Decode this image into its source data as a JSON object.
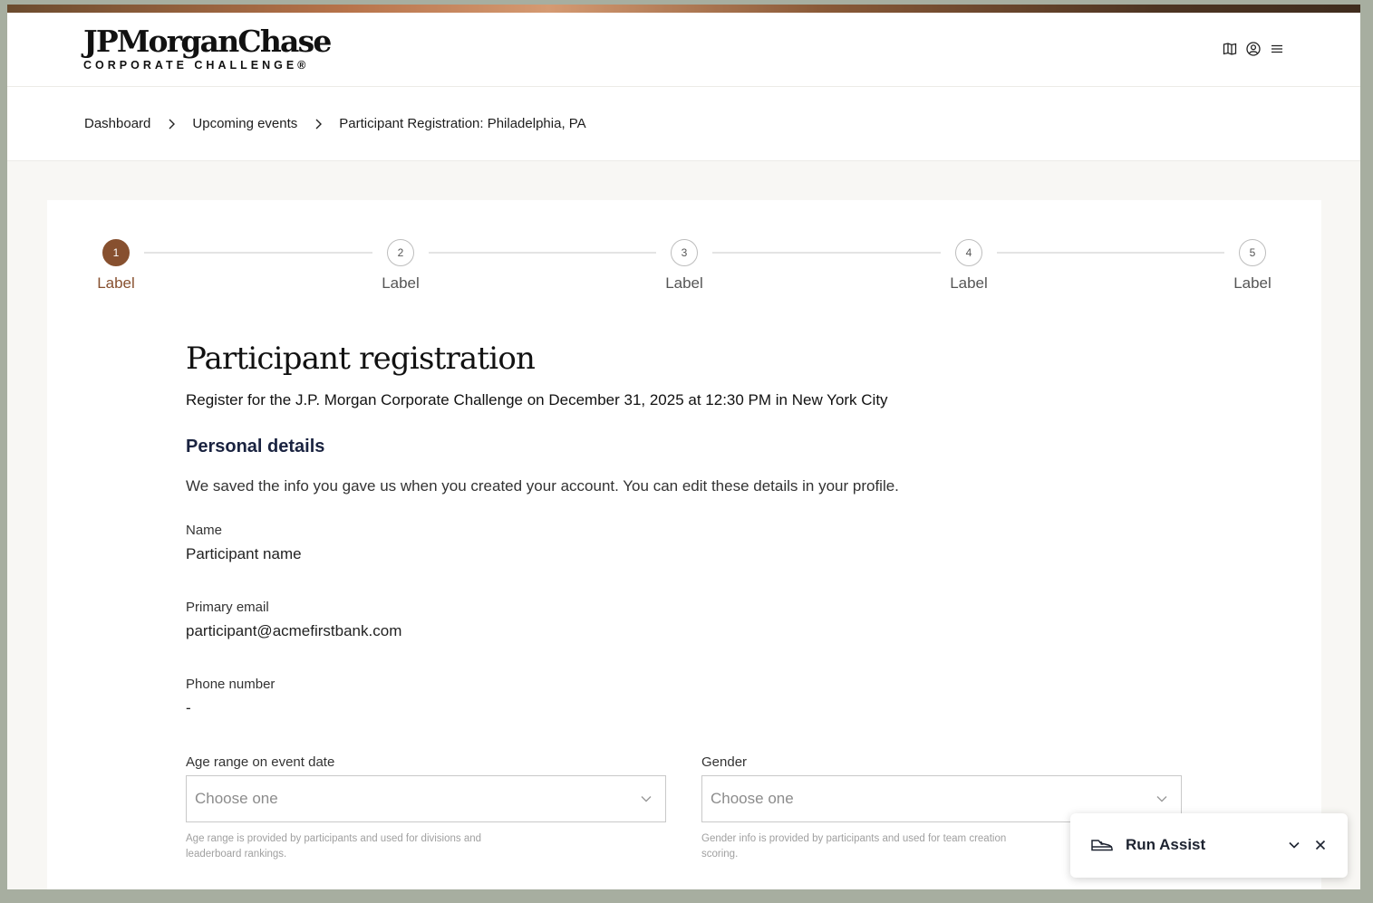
{
  "brand": {
    "logo_main": "JPMorganChase",
    "logo_sub": "CORPORATE CHALLENGE®"
  },
  "header": {
    "icons": [
      "book-icon",
      "user-icon",
      "menu-icon"
    ]
  },
  "breadcrumb": {
    "items": [
      {
        "label": "Dashboard"
      },
      {
        "label": "Upcoming events"
      },
      {
        "label": "Participant Registration: Philadelphia, PA"
      }
    ]
  },
  "stepper": {
    "active_step": 1,
    "steps": [
      {
        "number": "1",
        "label": "Label"
      },
      {
        "number": "2",
        "label": "Label"
      },
      {
        "number": "3",
        "label": "Label"
      },
      {
        "number": "4",
        "label": "Label"
      },
      {
        "number": "5",
        "label": "Label"
      }
    ]
  },
  "page": {
    "title": "Participant registration",
    "subtitle": "Register for the J.P. Morgan Corporate Challenge on December 31, 2025 at 12:30 PM in New York City",
    "section_title": "Personal details",
    "section_desc": "We saved the info you gave us when you created your account. You can edit these details in your profile."
  },
  "fields": {
    "name": {
      "label": "Name",
      "value": "Participant name"
    },
    "email": {
      "label": "Primary email",
      "value": "participant@acmefirstbank.com"
    },
    "phone": {
      "label": "Phone number",
      "value": "-"
    }
  },
  "selects": {
    "age": {
      "label": "Age range on event date",
      "placeholder": "Choose one",
      "helper": "Age range is provided by participants and used for divisions and leaderboard rankings."
    },
    "gender": {
      "label": "Gender",
      "placeholder": "Choose one",
      "helper": "Gender info is provided by participants and used for team creation scoring."
    }
  },
  "assist": {
    "label": "Run Assist"
  },
  "colors": {
    "accent": "#87502f",
    "outer_background": "#a7aea0",
    "page_background": "#f8f7f4"
  }
}
